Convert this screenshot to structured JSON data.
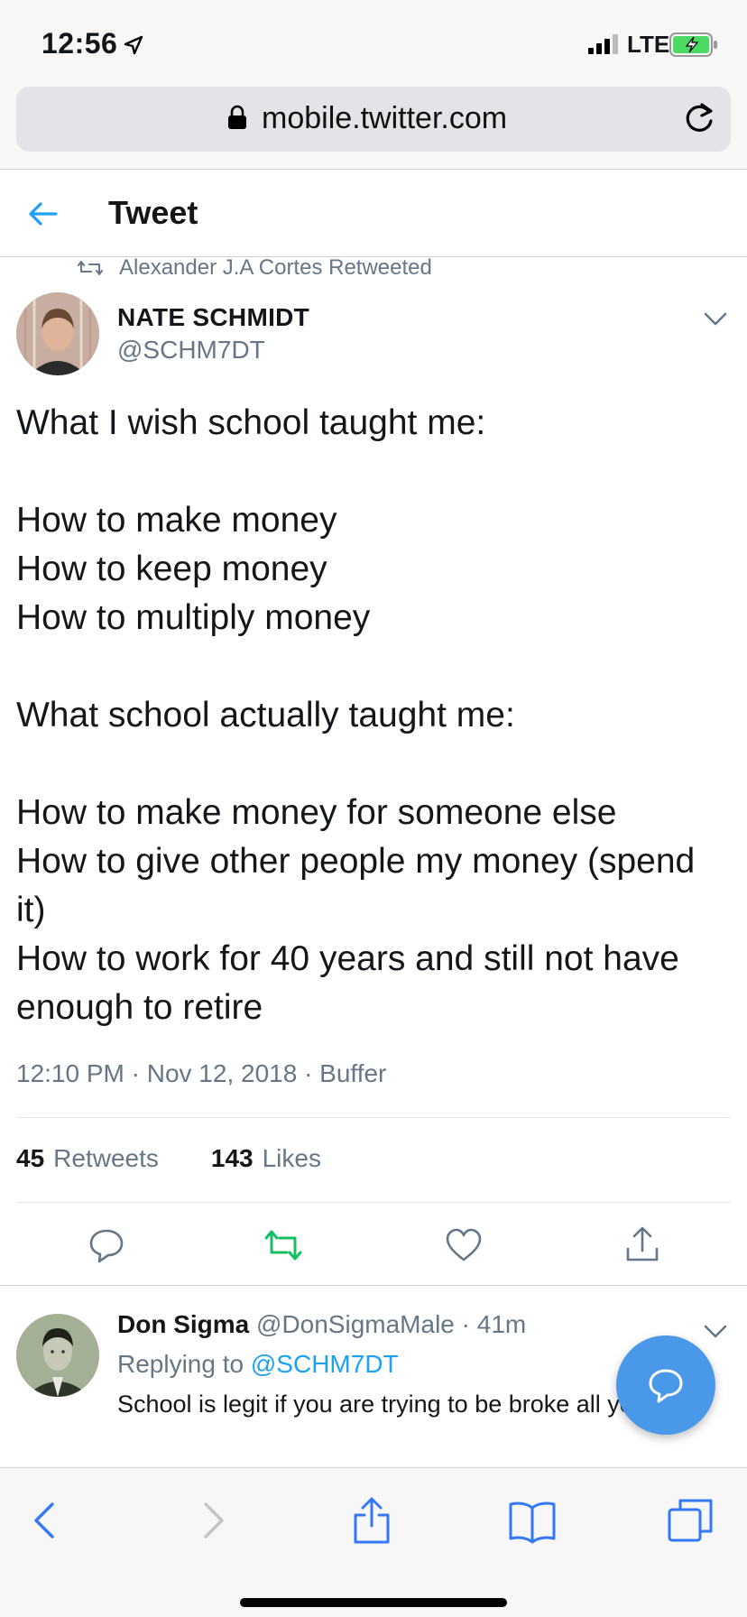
{
  "status_bar": {
    "time": "12:56",
    "network": "LTE"
  },
  "browser": {
    "url": "mobile.twitter.com"
  },
  "header": {
    "title": "Tweet"
  },
  "tweet": {
    "retweet_context": "Alexander J.A Cortes Retweeted",
    "author_name": "NATE SCHMIDT",
    "author_handle": "@SCHM7DT",
    "lines": [
      "What I wish school taught me:",
      "",
      "How to make money",
      "How to keep money",
      "How to multiply money",
      "",
      "What school actually taught me:",
      "",
      "How to make money for someone else",
      "How to give other people my money (spend",
      "it)",
      "How to work for 40 years and still not have",
      "enough to retire"
    ],
    "meta": "12:10 PM · Nov 12, 2018 · Buffer",
    "retweets_count": "45",
    "retweets_label": "Retweets",
    "likes_count": "143",
    "likes_label": "Likes"
  },
  "reply": {
    "name": "Don Sigma",
    "handle": "@DonSigmaMale",
    "time": "· 41m",
    "replying_prefix": "Replying to",
    "replying_to": "@SCHM7DT",
    "text": "School is legit if you are trying to be broke all your life."
  },
  "colors": {
    "accent": "#1da1f2",
    "retweet_green": "#17bf63",
    "secondary_text": "#657786",
    "fab": "#4a99e9"
  },
  "icons": [
    "location-arrow-icon",
    "signal-icon",
    "battery-icon",
    "lock-icon",
    "reload-icon",
    "back-arrow-icon",
    "retweet-icon",
    "chevron-down-icon",
    "reply-icon",
    "like-icon",
    "share-icon",
    "compose-icon",
    "safari-back-icon",
    "safari-forward-icon",
    "safari-share-icon",
    "bookmarks-icon",
    "tabs-icon"
  ]
}
